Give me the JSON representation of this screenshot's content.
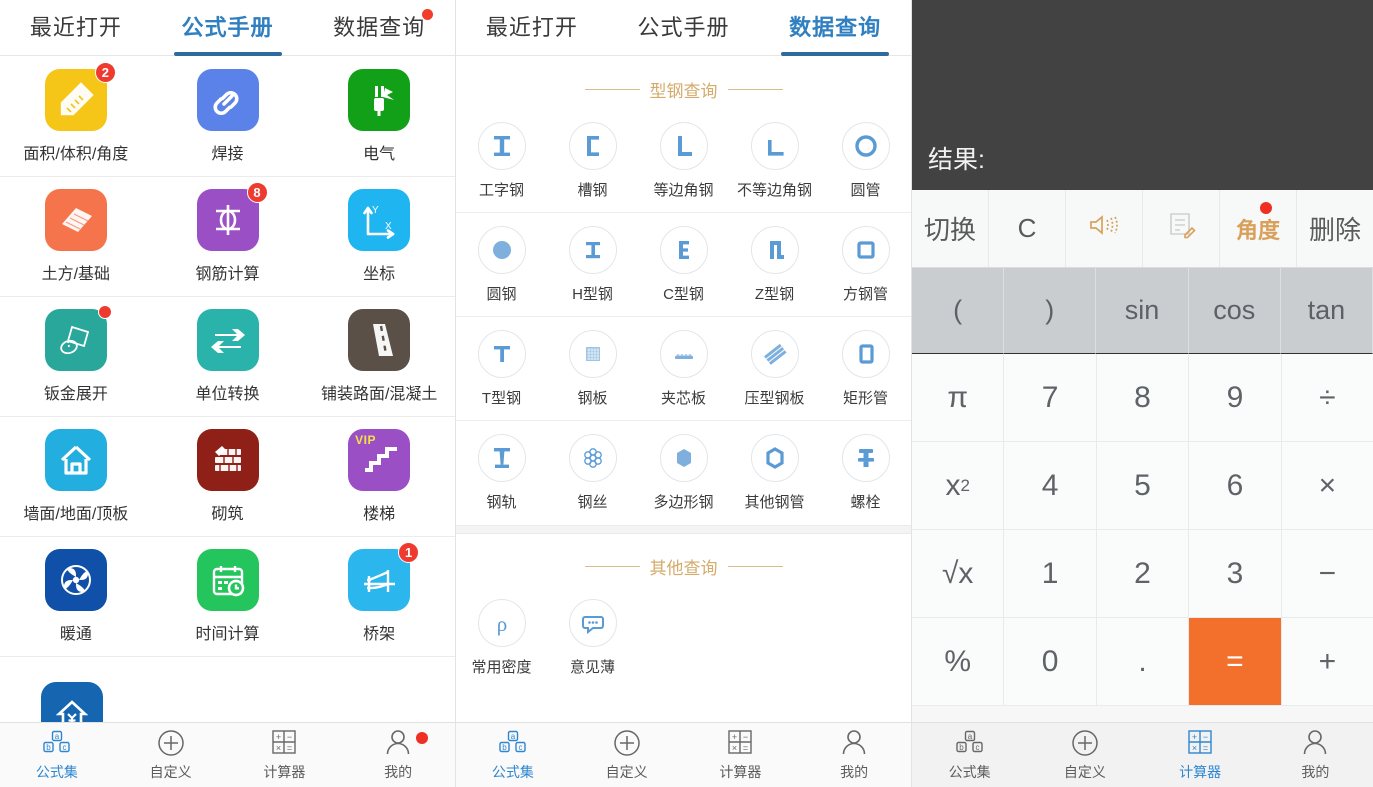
{
  "colors": {
    "accent_blue": "#2f7fc1",
    "tab_underline": "#2f6a9e",
    "badge_red": "#ef3b2f",
    "section_gold": "#d4ab6a",
    "equals_orange": "#f2702c",
    "display_bg": "#424242"
  },
  "panel1": {
    "tabs": [
      {
        "label": "最近打开",
        "active": false,
        "dot": false
      },
      {
        "label": "公式手册",
        "active": true,
        "dot": false
      },
      {
        "label": "数据查询",
        "active": false,
        "dot": true
      }
    ],
    "grid": [
      [
        {
          "label": "面积/体积/角度",
          "icon": "ruler-pencil-icon",
          "color": "#f5c517",
          "badge": "2"
        },
        {
          "label": "焊接",
          "icon": "chain-link-icon",
          "color": "#5b82e8",
          "badge": ""
        },
        {
          "label": "电气",
          "icon": "plug-bolt-icon",
          "color": "#13a019",
          "badge": ""
        }
      ],
      [
        {
          "label": "土方/基础",
          "icon": "earthwork-icon",
          "color": "#f5744c",
          "badge": ""
        },
        {
          "label": "钢筋计算",
          "icon": "rebar-icon",
          "color": "#9b4fc4",
          "badge": "8"
        },
        {
          "label": "坐标",
          "icon": "axes-xy-icon",
          "color": "#1fb5f0",
          "badge": ""
        }
      ],
      [
        {
          "label": "钣金展开",
          "icon": "sheetmetal-icon",
          "color": "#2aa79b",
          "badge": "dot"
        },
        {
          "label": "单位转换",
          "icon": "swap-arrows-icon",
          "color": "#2ab3aa",
          "badge": ""
        },
        {
          "label": "铺装路面/混凝土",
          "icon": "road-icon",
          "color": "#5a5048",
          "badge": ""
        }
      ],
      [
        {
          "label": "墙面/地面/顶板",
          "icon": "house-icon",
          "color": "#23aee0",
          "badge": ""
        },
        {
          "label": "砌筑",
          "icon": "brick-icon",
          "color": "#8e2017",
          "badge": ""
        },
        {
          "label": "楼梯",
          "icon": "stairs-icon",
          "color": "#9b4fc4",
          "badge": "",
          "vip": "VIP"
        }
      ],
      [
        {
          "label": "暖通",
          "icon": "fan-icon",
          "color": "#1050a8",
          "badge": ""
        },
        {
          "label": "时间计算",
          "icon": "calendar-clock-icon",
          "color": "#25c55e",
          "badge": ""
        },
        {
          "label": "桥架",
          "icon": "bridge-icon",
          "color": "#2bb6ee",
          "badge": "1"
        }
      ]
    ],
    "partial_icon": {
      "icon": "house-yuan-icon",
      "color": "#1565b0"
    },
    "bottom_nav": [
      {
        "label": "公式集",
        "icon": "abc-blocks-icon",
        "selected": true,
        "dot": false
      },
      {
        "label": "自定义",
        "icon": "plus-circle-icon",
        "selected": false,
        "dot": false
      },
      {
        "label": "计算器",
        "icon": "calculator-grid-icon",
        "selected": false,
        "dot": false
      },
      {
        "label": "我的",
        "icon": "person-icon",
        "selected": false,
        "dot": true
      }
    ]
  },
  "panel2": {
    "tabs": [
      {
        "label": "最近打开",
        "active": false,
        "dot": false
      },
      {
        "label": "公式手册",
        "active": false,
        "dot": false
      },
      {
        "label": "数据查询",
        "active": true,
        "dot": false
      }
    ],
    "sections": [
      {
        "title": "型钢查询",
        "rows": [
          [
            {
              "label": "工字钢",
              "icon": "i-beam-icon"
            },
            {
              "label": "槽钢",
              "icon": "channel-steel-icon"
            },
            {
              "label": "等边角钢",
              "icon": "equal-angle-icon"
            },
            {
              "label": "不等边角钢",
              "icon": "unequal-angle-icon"
            },
            {
              "label": "圆管",
              "icon": "round-pipe-icon"
            }
          ],
          [
            {
              "label": "圆钢",
              "icon": "round-bar-icon"
            },
            {
              "label": "H型钢",
              "icon": "h-beam-icon"
            },
            {
              "label": "C型钢",
              "icon": "c-section-icon"
            },
            {
              "label": "Z型钢",
              "icon": "z-section-icon"
            },
            {
              "label": "方钢管",
              "icon": "square-tube-icon"
            }
          ],
          [
            {
              "label": "T型钢",
              "icon": "t-section-icon"
            },
            {
              "label": "钢板",
              "icon": "steel-plate-icon"
            },
            {
              "label": "夹芯板",
              "icon": "sandwich-panel-icon"
            },
            {
              "label": "压型钢板",
              "icon": "profiled-sheet-icon"
            },
            {
              "label": "矩形管",
              "icon": "rect-tube-icon"
            }
          ],
          [
            {
              "label": "钢轨",
              "icon": "rail-icon"
            },
            {
              "label": "钢丝",
              "icon": "steel-wire-icon"
            },
            {
              "label": "多边形钢",
              "icon": "polygon-steel-icon"
            },
            {
              "label": "其他钢管",
              "icon": "other-pipe-icon"
            },
            {
              "label": "螺栓",
              "icon": "bolt-icon"
            }
          ]
        ]
      },
      {
        "title": "其他查询",
        "rows": [
          [
            {
              "label": "常用密度",
              "icon": "rho-density-icon"
            },
            {
              "label": "意见薄",
              "icon": "feedback-icon"
            }
          ]
        ]
      }
    ],
    "bottom_nav": [
      {
        "label": "公式集",
        "icon": "abc-blocks-icon",
        "selected": true,
        "dot": false
      },
      {
        "label": "自定义",
        "icon": "plus-circle-icon",
        "selected": false,
        "dot": false
      },
      {
        "label": "计算器",
        "icon": "calculator-grid-icon",
        "selected": false,
        "dot": false
      },
      {
        "label": "我的",
        "icon": "person-icon",
        "selected": false,
        "dot": false
      }
    ]
  },
  "panel3": {
    "display": {
      "expression": "",
      "result_label": "结果:"
    },
    "toolbar": [
      {
        "label": "切换",
        "icon": "",
        "style": "text",
        "dot": false
      },
      {
        "label": "C",
        "icon": "",
        "style": "text",
        "dot": false
      },
      {
        "label": "",
        "icon": "speaker-icon",
        "style": "icon",
        "dot": false
      },
      {
        "label": "",
        "icon": "note-edit-icon",
        "style": "icon",
        "dot": false
      },
      {
        "label": "角度",
        "icon": "",
        "style": "gold",
        "dot": true
      },
      {
        "label": "删除",
        "icon": "",
        "style": "text",
        "dot": false
      }
    ],
    "keys": [
      [
        {
          "label": "(",
          "type": "fn"
        },
        {
          "label": ")",
          "type": "fn"
        },
        {
          "label": "sin",
          "type": "fn"
        },
        {
          "label": "cos",
          "type": "fn"
        },
        {
          "label": "tan",
          "type": "fn"
        }
      ],
      [
        {
          "label": "π",
          "type": "num"
        },
        {
          "label": "7",
          "type": "num"
        },
        {
          "label": "8",
          "type": "num"
        },
        {
          "label": "9",
          "type": "num"
        },
        {
          "label": "÷",
          "type": "num"
        }
      ],
      [
        {
          "label": "x²",
          "type": "num"
        },
        {
          "label": "4",
          "type": "num"
        },
        {
          "label": "5",
          "type": "num"
        },
        {
          "label": "6",
          "type": "num"
        },
        {
          "label": "×",
          "type": "num"
        }
      ],
      [
        {
          "label": "√x",
          "type": "num"
        },
        {
          "label": "1",
          "type": "num"
        },
        {
          "label": "2",
          "type": "num"
        },
        {
          "label": "3",
          "type": "num"
        },
        {
          "label": "−",
          "type": "num"
        }
      ],
      [
        {
          "label": "%",
          "type": "num"
        },
        {
          "label": "0",
          "type": "num"
        },
        {
          "label": ".",
          "type": "num"
        },
        {
          "label": "=",
          "type": "eq"
        },
        {
          "label": "+",
          "type": "num"
        }
      ]
    ],
    "bottom_nav": [
      {
        "label": "公式集",
        "icon": "abc-blocks-icon",
        "selected": false,
        "dot": false
      },
      {
        "label": "自定义",
        "icon": "plus-circle-icon",
        "selected": false,
        "dot": false
      },
      {
        "label": "计算器",
        "icon": "calculator-grid-icon",
        "selected": true,
        "dot": false
      },
      {
        "label": "我的",
        "icon": "person-icon",
        "selected": false,
        "dot": false
      }
    ]
  }
}
